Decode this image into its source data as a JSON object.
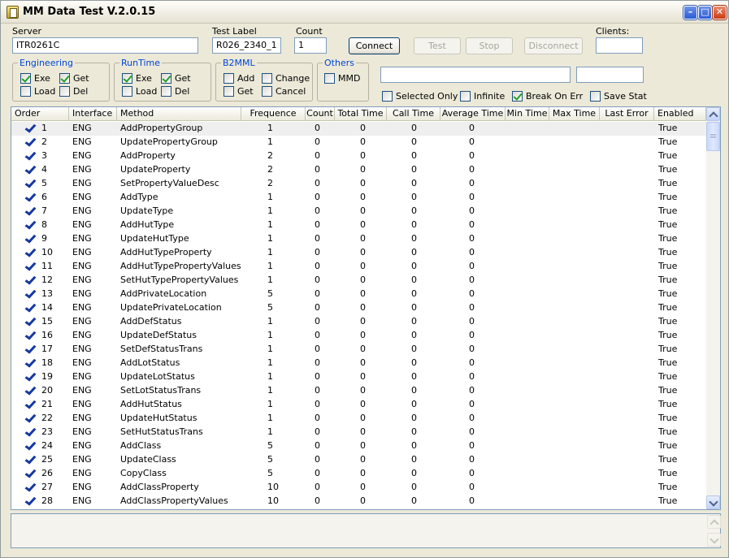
{
  "window": {
    "title": "MM Data Test V.2.0.15",
    "minimize_glyph": "–",
    "maximize_glyph": "□",
    "close_glyph": "✕"
  },
  "server": {
    "label": "Server",
    "value": "ITR0261C"
  },
  "test_label": {
    "label": "Test Label",
    "value": "R026_2340_1"
  },
  "count": {
    "label": "Count",
    "value": "1"
  },
  "clients": {
    "label": "Clients:",
    "value": ""
  },
  "buttons": {
    "connect": "Connect",
    "test": "Test",
    "stop": "Stop",
    "disconnect": "Disconnect"
  },
  "groups": {
    "engineering": {
      "title": "Engineering",
      "exe": {
        "label": "Exe",
        "checked": true
      },
      "get": {
        "label": "Get",
        "checked": true
      },
      "load": {
        "label": "Load",
        "checked": false
      },
      "del": {
        "label": "Del",
        "checked": false
      }
    },
    "runtime": {
      "title": "RunTime",
      "exe": {
        "label": "Exe",
        "checked": true
      },
      "get": {
        "label": "Get",
        "checked": true
      },
      "load": {
        "label": "Load",
        "checked": false
      },
      "del": {
        "label": "Del",
        "checked": false
      }
    },
    "b2mml": {
      "title": "B2MML",
      "add": {
        "label": "Add",
        "checked": false
      },
      "change": {
        "label": "Change",
        "checked": false
      },
      "get": {
        "label": "Get",
        "checked": false
      },
      "cancel": {
        "label": "Cancel",
        "checked": false
      }
    },
    "others": {
      "title": "Others",
      "mmd": {
        "label": "MMD",
        "checked": false
      }
    }
  },
  "status_field_1": "",
  "status_field_2": "",
  "options": {
    "selected_only": {
      "label": "Selected Only",
      "checked": false
    },
    "infinite": {
      "label": "Infinite",
      "checked": false
    },
    "break_on_err": {
      "label": "Break On Err",
      "checked": true
    },
    "save_stat": {
      "label": "Save Stat",
      "checked": false
    }
  },
  "grid": {
    "columns": [
      "Order",
      "Interface",
      "Method",
      "Frequence",
      "Count",
      "Total Time",
      "Call Time",
      "Average Time",
      "Min Time",
      "Max Time",
      "Last Error",
      "Enabled"
    ],
    "rows": [
      [
        "1",
        "ENG",
        "AddPropertyGroup",
        "1",
        "0",
        "0",
        "0",
        "0",
        "",
        "",
        "",
        "True"
      ],
      [
        "2",
        "ENG",
        "UpdatePropertyGroup",
        "1",
        "0",
        "0",
        "0",
        "0",
        "",
        "",
        "",
        "True"
      ],
      [
        "3",
        "ENG",
        "AddProperty",
        "2",
        "0",
        "0",
        "0",
        "0",
        "",
        "",
        "",
        "True"
      ],
      [
        "4",
        "ENG",
        "UpdateProperty",
        "2",
        "0",
        "0",
        "0",
        "0",
        "",
        "",
        "",
        "True"
      ],
      [
        "5",
        "ENG",
        "SetPropertyValueDesc",
        "2",
        "0",
        "0",
        "0",
        "0",
        "",
        "",
        "",
        "True"
      ],
      [
        "6",
        "ENG",
        "AddType",
        "1",
        "0",
        "0",
        "0",
        "0",
        "",
        "",
        "",
        "True"
      ],
      [
        "7",
        "ENG",
        "UpdateType",
        "1",
        "0",
        "0",
        "0",
        "0",
        "",
        "",
        "",
        "True"
      ],
      [
        "8",
        "ENG",
        "AddHutType",
        "1",
        "0",
        "0",
        "0",
        "0",
        "",
        "",
        "",
        "True"
      ],
      [
        "9",
        "ENG",
        "UpdateHutType",
        "1",
        "0",
        "0",
        "0",
        "0",
        "",
        "",
        "",
        "True"
      ],
      [
        "10",
        "ENG",
        "AddHutTypeProperty",
        "1",
        "0",
        "0",
        "0",
        "0",
        "",
        "",
        "",
        "True"
      ],
      [
        "11",
        "ENG",
        "AddHutTypePropertyValues",
        "1",
        "0",
        "0",
        "0",
        "0",
        "",
        "",
        "",
        "True"
      ],
      [
        "12",
        "ENG",
        "SetHutTypePropertyValues",
        "1",
        "0",
        "0",
        "0",
        "0",
        "",
        "",
        "",
        "True"
      ],
      [
        "13",
        "ENG",
        "AddPrivateLocation",
        "5",
        "0",
        "0",
        "0",
        "0",
        "",
        "",
        "",
        "True"
      ],
      [
        "14",
        "ENG",
        "UpdatePrivateLocation",
        "5",
        "0",
        "0",
        "0",
        "0",
        "",
        "",
        "",
        "True"
      ],
      [
        "15",
        "ENG",
        "AddDefStatus",
        "1",
        "0",
        "0",
        "0",
        "0",
        "",
        "",
        "",
        "True"
      ],
      [
        "16",
        "ENG",
        "UpdateDefStatus",
        "1",
        "0",
        "0",
        "0",
        "0",
        "",
        "",
        "",
        "True"
      ],
      [
        "17",
        "ENG",
        "SetDefStatusTrans",
        "1",
        "0",
        "0",
        "0",
        "0",
        "",
        "",
        "",
        "True"
      ],
      [
        "18",
        "ENG",
        "AddLotStatus",
        "1",
        "0",
        "0",
        "0",
        "0",
        "",
        "",
        "",
        "True"
      ],
      [
        "19",
        "ENG",
        "UpdateLotStatus",
        "1",
        "0",
        "0",
        "0",
        "0",
        "",
        "",
        "",
        "True"
      ],
      [
        "20",
        "ENG",
        "SetLotStatusTrans",
        "1",
        "0",
        "0",
        "0",
        "0",
        "",
        "",
        "",
        "True"
      ],
      [
        "21",
        "ENG",
        "AddHutStatus",
        "1",
        "0",
        "0",
        "0",
        "0",
        "",
        "",
        "",
        "True"
      ],
      [
        "22",
        "ENG",
        "UpdateHutStatus",
        "1",
        "0",
        "0",
        "0",
        "0",
        "",
        "",
        "",
        "True"
      ],
      [
        "23",
        "ENG",
        "SetHutStatusTrans",
        "1",
        "0",
        "0",
        "0",
        "0",
        "",
        "",
        "",
        "True"
      ],
      [
        "24",
        "ENG",
        "AddClass",
        "5",
        "0",
        "0",
        "0",
        "0",
        "",
        "",
        "",
        "True"
      ],
      [
        "25",
        "ENG",
        "UpdateClass",
        "5",
        "0",
        "0",
        "0",
        "0",
        "",
        "",
        "",
        "True"
      ],
      [
        "26",
        "ENG",
        "CopyClass",
        "5",
        "0",
        "0",
        "0",
        "0",
        "",
        "",
        "",
        "True"
      ],
      [
        "27",
        "ENG",
        "AddClassProperty",
        "10",
        "0",
        "0",
        "0",
        "0",
        "",
        "",
        "",
        "True"
      ],
      [
        "28",
        "ENG",
        "AddClassPropertyValues",
        "10",
        "0",
        "0",
        "0",
        "0",
        "",
        "",
        "",
        "True"
      ]
    ]
  },
  "log": {
    "text": ""
  }
}
